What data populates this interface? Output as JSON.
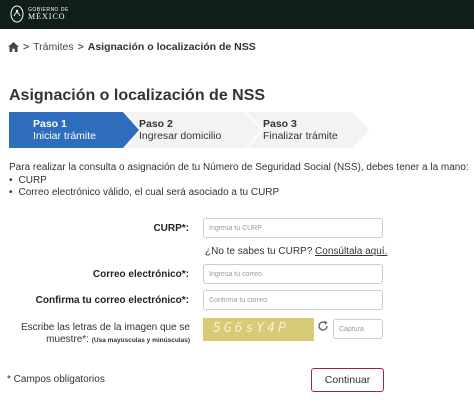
{
  "header": {
    "logo_small": "GOBIERNO DE",
    "logo_big": "MÉXICO",
    "logo_icon": "eagle-emblem-icon"
  },
  "breadcrumb": {
    "home_icon": "home-icon",
    "item1": "Trámites",
    "separator": ">",
    "current": "Asignación o localización de NSS"
  },
  "page_title": "Asignación o localización de NSS",
  "steps": [
    {
      "num": "Paso 1",
      "label": "Iniciar trámite",
      "active": true
    },
    {
      "num": "Paso 2",
      "label": "Ingresar domicilio",
      "active": false
    },
    {
      "num": "Paso 3",
      "label": "Finalizar trámite",
      "active": false
    }
  ],
  "intro": "Para realizar la consulta o asignación de tu Número de Seguridad Social (NSS), debes tener a la mano:",
  "requirements": [
    "CURP",
    "Correo electrónico válido, el cual será asociado a tu CURP"
  ],
  "form": {
    "curp_label": "CURP*:",
    "curp_placeholder": "Ingresa tu CURP",
    "curp_help": "¿No te sabes tu CURP?",
    "curp_help_link": "Consúltala aquí.",
    "email_label": "Correo electrónico*:",
    "email_placeholder": "Ingresa tu correo",
    "confirm_label": "Confirma tu correo electrónico*:",
    "confirm_placeholder": "Confirma tu correo",
    "captcha_label": "Escribe las letras de la imagen que se muestre*:",
    "captcha_hint": "(Usa mayúsculas y minúsculas)",
    "captcha_text": "5G6sY4P",
    "captcha_placeholder": "Captura",
    "refresh_icon": "refresh-icon"
  },
  "required_note": "* Campos obligatorios",
  "continue_label": "Continuar",
  "colors": {
    "header_bg": "#0f1e16",
    "step_active": "#2e6dbe",
    "step_inactive": "#f3f3f3",
    "button_border": "#9d2449"
  }
}
